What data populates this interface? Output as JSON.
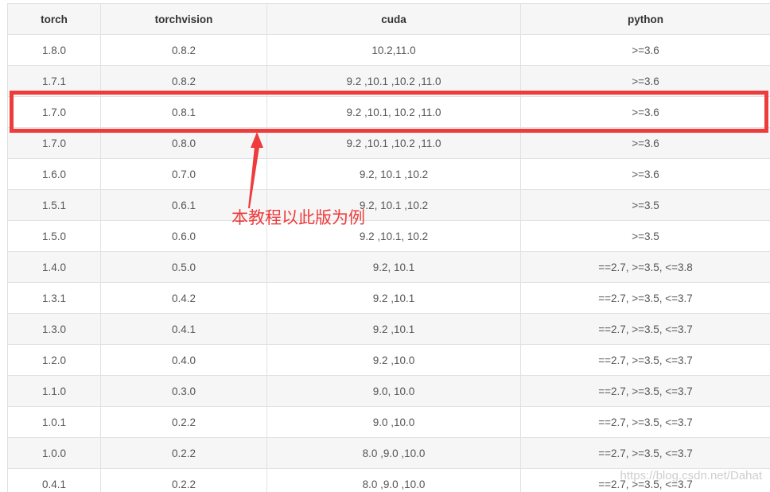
{
  "table": {
    "headers": [
      "torch",
      "torchvision",
      "cuda",
      "python"
    ],
    "rows": [
      [
        "1.8.0",
        "0.8.2",
        "10.2,11.0",
        ">=3.6"
      ],
      [
        "1.7.1",
        "0.8.2",
        "9.2 ,10.1 ,10.2 ,11.0",
        ">=3.6"
      ],
      [
        "1.7.0",
        "0.8.1",
        "9.2 ,10.1, 10.2 ,11.0",
        ">=3.6"
      ],
      [
        "1.7.0",
        "0.8.0",
        "9.2 ,10.1 ,10.2 ,11.0",
        ">=3.6"
      ],
      [
        "1.6.0",
        "0.7.0",
        "9.2, 10.1 ,10.2",
        ">=3.6"
      ],
      [
        "1.5.1",
        "0.6.1",
        "9.2, 10.1 ,10.2",
        ">=3.5"
      ],
      [
        "1.5.0",
        "0.6.0",
        "9.2 ,10.1, 10.2",
        ">=3.5"
      ],
      [
        "1.4.0",
        "0.5.0",
        "9.2, 10.1",
        "==2.7, >=3.5, <=3.8"
      ],
      [
        "1.3.1",
        "0.4.2",
        "9.2 ,10.1",
        "==2.7, >=3.5, <=3.7"
      ],
      [
        "1.3.0",
        "0.4.1",
        "9.2 ,10.1",
        "==2.7, >=3.5, <=3.7"
      ],
      [
        "1.2.0",
        "0.4.0",
        "9.2 ,10.0",
        "==2.7, >=3.5, <=3.7"
      ],
      [
        "1.1.0",
        "0.3.0",
        "9.0, 10.0",
        "==2.7, >=3.5, <=3.7"
      ],
      [
        "1.0.1",
        "0.2.2",
        "9.0 ,10.0",
        "==2.7, >=3.5, <=3.7"
      ],
      [
        "1.0.0",
        "0.2.2",
        "8.0 ,9.0 ,10.0",
        "==2.7, >=3.5, <=3.7"
      ],
      [
        "0.4.1",
        "0.2.2",
        "8.0 ,9.0 ,10.0",
        "==2.7, >=3.5, <=3.7"
      ]
    ]
  },
  "annotation": {
    "text": "本教程以此版为例",
    "color": "#ee3b3b"
  },
  "watermark": {
    "text": "https://blog.csdn.net/Dahat"
  },
  "colors": {
    "header_bg": "#f6f6f6",
    "stripe_bg": "#f6f6f6",
    "border": "#dfe2e5",
    "highlight": "#ee3b3b"
  }
}
